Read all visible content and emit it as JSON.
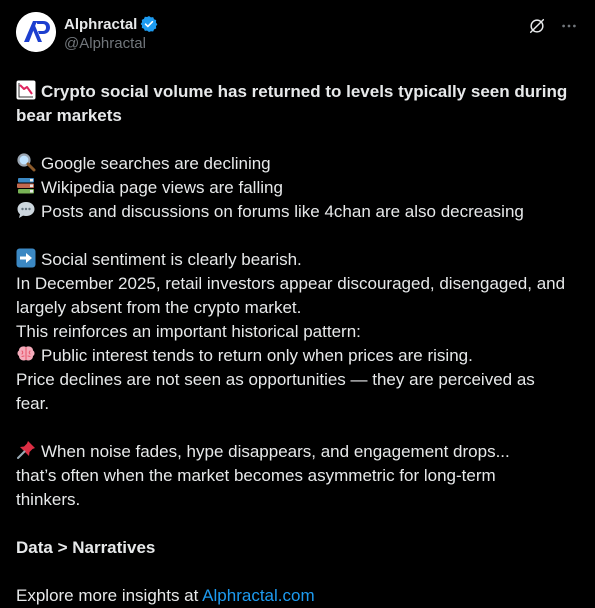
{
  "author": {
    "display_name": "Alphractal",
    "handle": "@Alphractal",
    "avatar_initials": "AP",
    "verified": true
  },
  "header_icons": [
    "grok-icon",
    "more-icon"
  ],
  "post": {
    "title_line1": "Crypto social volume has returned to levels typically seen during",
    "title_line2": "bear markets",
    "google_line": "Google searches are declining",
    "wiki_line": "Wikipedia page views are falling",
    "forum_line": "Posts and discussions on forums like 4chan are also decreasing",
    "sentiment_line": "Social sentiment is clearly bearish.",
    "december_line1": "In December 2025, retail investors appear discouraged, disengaged, and",
    "december_line2": "largely absent from the crypto market.",
    "pattern_line": "This reinforces an important historical pattern:",
    "interest_line": "Public interest tends to return only when prices are rising.",
    "decline_line1": "Price declines are not seen as opportunities — they are perceived as",
    "decline_line2": "fear.",
    "noise_line": "When noise fades, hype disappears, and engagement drops...",
    "asym_line1": "that’s often when the market becomes asymmetric for long-term",
    "asym_line2": "thinkers.",
    "data_line": "Data > Narratives",
    "explore_prefix": "Explore more insights at",
    "explore_link": "Alphractal.com"
  },
  "colors": {
    "background": "#000000",
    "text": "#e7e9ea",
    "muted": "#71767b",
    "link": "#1d9bf0",
    "verified": "#1d9bf0",
    "logo": "#1d3fcf"
  }
}
